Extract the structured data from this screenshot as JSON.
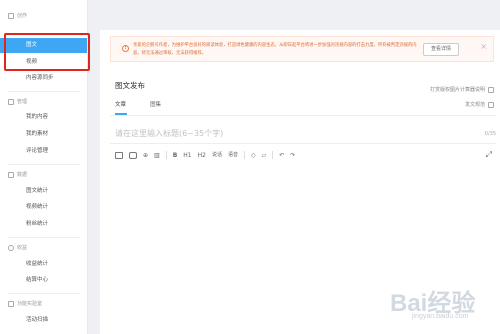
{
  "sidebar": {
    "sections": [
      {
        "label": "创作",
        "icon": "edit-icon"
      },
      {
        "label": "管理",
        "icon": "folder-icon"
      },
      {
        "label": "数据",
        "icon": "chart-icon"
      },
      {
        "label": "收益",
        "icon": "coin-icon"
      },
      {
        "label": "功能实验室",
        "icon": "lab-icon"
      }
    ],
    "items": [
      {
        "label": "图文",
        "active": true
      },
      {
        "label": "视频",
        "active": false
      },
      {
        "label": "内容源同步",
        "active": false
      },
      {
        "label": "我的内容",
        "active": false
      },
      {
        "label": "我的素材",
        "active": false
      },
      {
        "label": "评论管理",
        "active": false
      },
      {
        "label": "图文统计",
        "active": false
      },
      {
        "label": "视频统计",
        "active": false
      },
      {
        "label": "粉丝统计",
        "active": false
      },
      {
        "label": "收益统计",
        "active": false
      },
      {
        "label": "结算中心",
        "active": false
      },
      {
        "label": "活动扫描",
        "active": false
      }
    ]
  },
  "notice": {
    "text": "亲爱的企鹅号作者，为维护平台良好的阅读体验，打造绿色健康的内容生态，从即日起平台将进一步加强对违规内容的打击力度，所有被判定违规的内容，将无法通过审核，无法获得推荐。",
    "button": "查看详情",
    "color": "#d66a35"
  },
  "editor": {
    "title": "图文发布",
    "link_top": "打赏版权图片计算器说明",
    "link_bottom": "发文规范",
    "tabs": [
      "文章",
      "图集"
    ],
    "headline_placeholder": "请在这里输入标题(6~35个字)",
    "count": "0/35",
    "toolbar": [
      "image-icon",
      "video-icon",
      "link-icon",
      "chart-icon",
      "B",
      "H1",
      "H2",
      "说话",
      "语音",
      "eraser-icon",
      "highlight-icon",
      "undo-icon",
      "redo-icon"
    ]
  },
  "watermark": {
    "brand": "Bai经验",
    "url": "jingyan.baidu.com"
  },
  "colors": {
    "accent": "#3ea7f3",
    "highlight_box": "#e1251b"
  }
}
